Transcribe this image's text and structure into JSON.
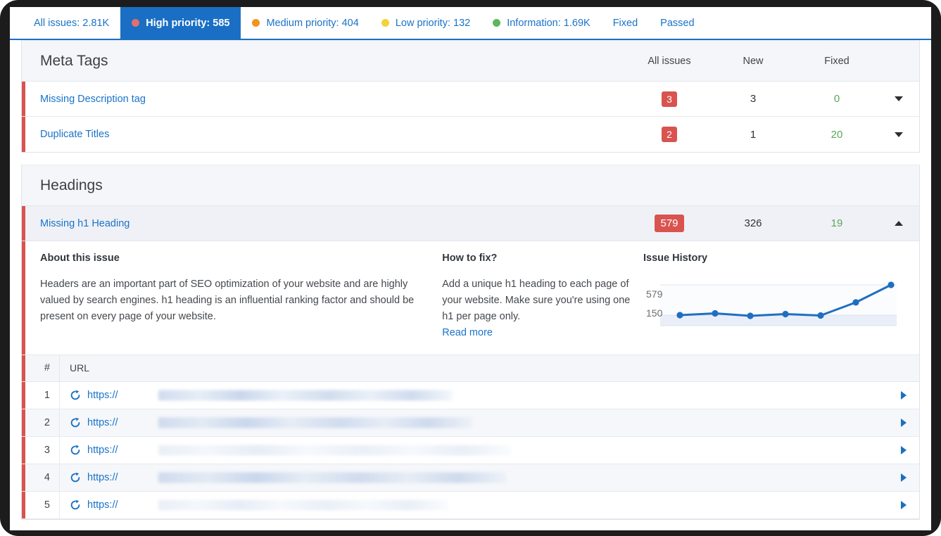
{
  "tabs": [
    {
      "label": "All issues: 2.81K",
      "dot": null,
      "active": false
    },
    {
      "label": "High priority: 585",
      "dot": "#e2706d",
      "active": true
    },
    {
      "label": "Medium priority: 404",
      "dot": "#f5921e",
      "active": false
    },
    {
      "label": "Low priority: 132",
      "dot": "#f2d338",
      "active": false
    },
    {
      "label": "Information: 1.69K",
      "dot": "#5cb85c",
      "active": false
    },
    {
      "label": "Fixed",
      "dot": null,
      "active": false
    },
    {
      "label": "Passed",
      "dot": null,
      "active": false
    }
  ],
  "columns": {
    "all_issues": "All issues",
    "new": "New",
    "fixed": "Fixed"
  },
  "sections": [
    {
      "title": "Meta Tags",
      "rows": [
        {
          "name": "Missing Description tag",
          "all_issues": "3",
          "new": "3",
          "fixed": "0",
          "expanded": false,
          "chevron": "chevron-down-icon"
        },
        {
          "name": "Duplicate Titles",
          "all_issues": "2",
          "new": "1",
          "fixed": "20",
          "expanded": false,
          "chevron": "chevron-down-icon"
        }
      ]
    },
    {
      "title": "Headings",
      "rows": [
        {
          "name": "Missing h1 Heading",
          "all_issues": "579",
          "new": "326",
          "fixed": "19",
          "expanded": true,
          "chevron": "chevron-up-icon"
        }
      ]
    }
  ],
  "detail": {
    "about_heading": "About this issue",
    "about_text": "Headers are an important part of SEO optimization of your website and are highly valued by search engines. h1 heading is an influential ranking factor and should be present on every page of your website.",
    "fix_heading": "How to fix?",
    "fix_text": "Add a unique h1 heading to each page of your website. Make sure you're using one h1 per page only.",
    "read_more": "Read more",
    "history_heading": "Issue History"
  },
  "chart_data": {
    "type": "line",
    "title": "Issue History",
    "xlabel": "",
    "ylabel": "",
    "x": [
      1,
      2,
      3,
      4,
      5,
      6,
      7
    ],
    "values": [
      150,
      175,
      140,
      165,
      145,
      330,
      579
    ],
    "tick_labels": [
      "150",
      "579"
    ],
    "ylim": [
      0,
      640
    ],
    "gridlines": [
      0,
      150,
      579
    ],
    "grid": true,
    "legend": false,
    "line_color": "#1f6fc0",
    "marker_color": "#1f6fc0",
    "area_fill": "#e8eef8"
  },
  "url_table": {
    "headers": {
      "num": "#",
      "url": "URL"
    },
    "rows": [
      {
        "num": "1",
        "protocol": "https://",
        "redacted_width": 418,
        "faint": false,
        "chevron": "chevron-right-icon"
      },
      {
        "num": "2",
        "protocol": "https://",
        "redacted_width": 446,
        "faint": false,
        "chevron": "chevron-right-icon"
      },
      {
        "num": "3",
        "protocol": "https://",
        "redacted_width": 502,
        "faint": true,
        "chevron": "chevron-right-icon"
      },
      {
        "num": "4",
        "protocol": "https://",
        "redacted_width": 494,
        "faint": false,
        "chevron": "chevron-right-icon"
      },
      {
        "num": "5",
        "protocol": "https://",
        "redacted_width": 412,
        "faint": true,
        "chevron": "chevron-right-icon"
      }
    ]
  },
  "colors": {
    "accent_blue": "#1a6fc4",
    "link_blue": "#1a73c8",
    "high_priority_red": "#d9534f",
    "fixed_green": "#5ba75b"
  }
}
